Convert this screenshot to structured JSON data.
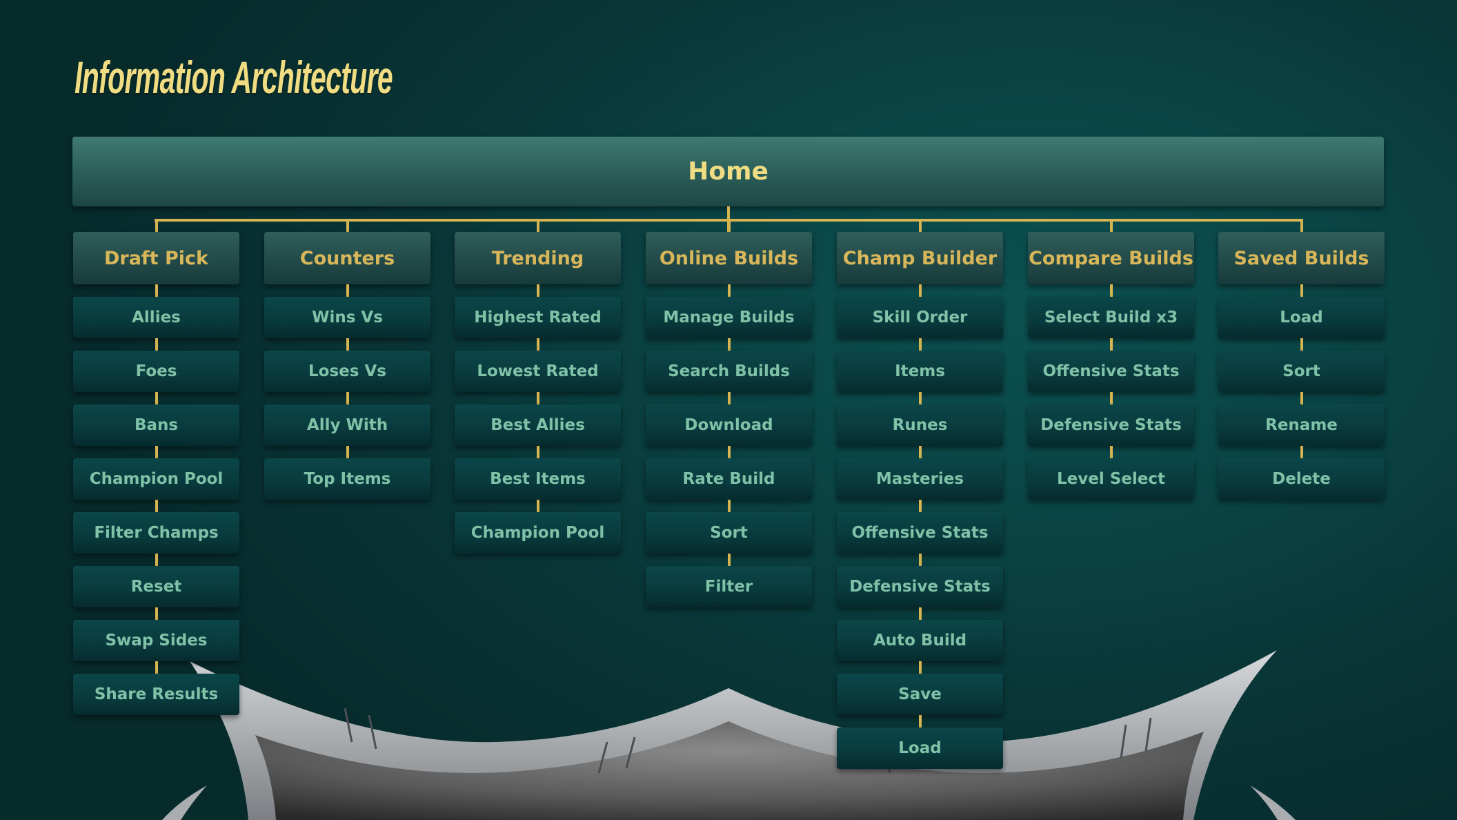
{
  "page": {
    "title": "Information Architecture"
  },
  "colors": {
    "title": "#f0dc82",
    "home_text": "#f0dc82",
    "category_text": "#d8b65a",
    "child_text": "#80c2a8",
    "connector": "#d6b452",
    "background": "#0a4445"
  },
  "tree": {
    "root": {
      "label": "Home"
    },
    "categories": [
      {
        "label": "Draft Pick",
        "children": [
          "Allies",
          "Foes",
          "Bans",
          "Champion Pool",
          "Filter Champs",
          "Reset",
          "Swap Sides",
          "Share Results"
        ]
      },
      {
        "label": "Counters",
        "children": [
          "Wins Vs",
          "Loses Vs",
          "Ally With",
          "Top Items"
        ]
      },
      {
        "label": "Trending",
        "children": [
          "Highest Rated",
          "Lowest Rated",
          "Best Allies",
          "Best Items",
          "Champion Pool"
        ]
      },
      {
        "label": "Online Builds",
        "children": [
          "Manage Builds",
          "Search Builds",
          "Download",
          "Rate Build",
          "Sort",
          "Filter"
        ]
      },
      {
        "label": "Champ Builder",
        "children": [
          "Skill Order",
          "Items",
          "Runes",
          "Masteries",
          "Offensive Stats",
          "Defensive Stats",
          "Auto Build",
          "Save",
          "Load"
        ]
      },
      {
        "label": "Compare Builds",
        "children": [
          "Select Build x3",
          "Offensive Stats",
          "Defensive Stats",
          "Level Select"
        ]
      },
      {
        "label": "Saved Builds",
        "children": [
          "Load",
          "Sort",
          "Rename",
          "Delete"
        ]
      }
    ]
  }
}
